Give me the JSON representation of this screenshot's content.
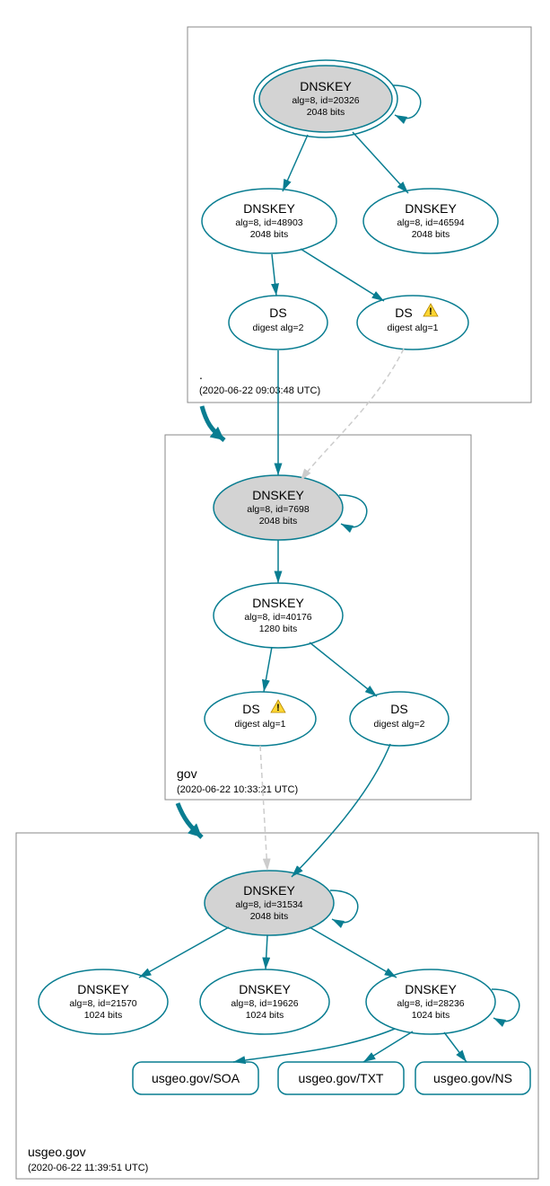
{
  "zones": {
    "root": {
      "label": ".",
      "date": "(2020-06-22 09:03:48 UTC)"
    },
    "gov": {
      "label": "gov",
      "date": "(2020-06-22 10:33:21 UTC)"
    },
    "usgeo": {
      "label": "usgeo.gov",
      "date": "(2020-06-22 11:39:51 UTC)"
    }
  },
  "nodes": {
    "root_ksk": {
      "title": "DNSKEY",
      "line1": "alg=8, id=20326",
      "line2": "2048 bits"
    },
    "root_zsk1": {
      "title": "DNSKEY",
      "line1": "alg=8, id=48903",
      "line2": "2048 bits"
    },
    "root_zsk2": {
      "title": "DNSKEY",
      "line1": "alg=8, id=46594",
      "line2": "2048 bits"
    },
    "root_ds2": {
      "title": "DS",
      "line1": "digest alg=2"
    },
    "root_ds1": {
      "title": "DS",
      "line1": "digest alg=1"
    },
    "gov_ksk": {
      "title": "DNSKEY",
      "line1": "alg=8, id=7698",
      "line2": "2048 bits"
    },
    "gov_zsk": {
      "title": "DNSKEY",
      "line1": "alg=8, id=40176",
      "line2": "1280 bits"
    },
    "gov_ds1": {
      "title": "DS",
      "line1": "digest alg=1"
    },
    "gov_ds2": {
      "title": "DS",
      "line1": "digest alg=2"
    },
    "usgeo_ksk": {
      "title": "DNSKEY",
      "line1": "alg=8, id=31534",
      "line2": "2048 bits"
    },
    "usgeo_zska": {
      "title": "DNSKEY",
      "line1": "alg=8, id=21570",
      "line2": "1024 bits"
    },
    "usgeo_zskb": {
      "title": "DNSKEY",
      "line1": "alg=8, id=19626",
      "line2": "1024 bits"
    },
    "usgeo_zskc": {
      "title": "DNSKEY",
      "line1": "alg=8, id=28236",
      "line2": "1024 bits"
    }
  },
  "rr": {
    "soa": "usgeo.gov/SOA",
    "txt": "usgeo.gov/TXT",
    "ns": "usgeo.gov/NS"
  }
}
